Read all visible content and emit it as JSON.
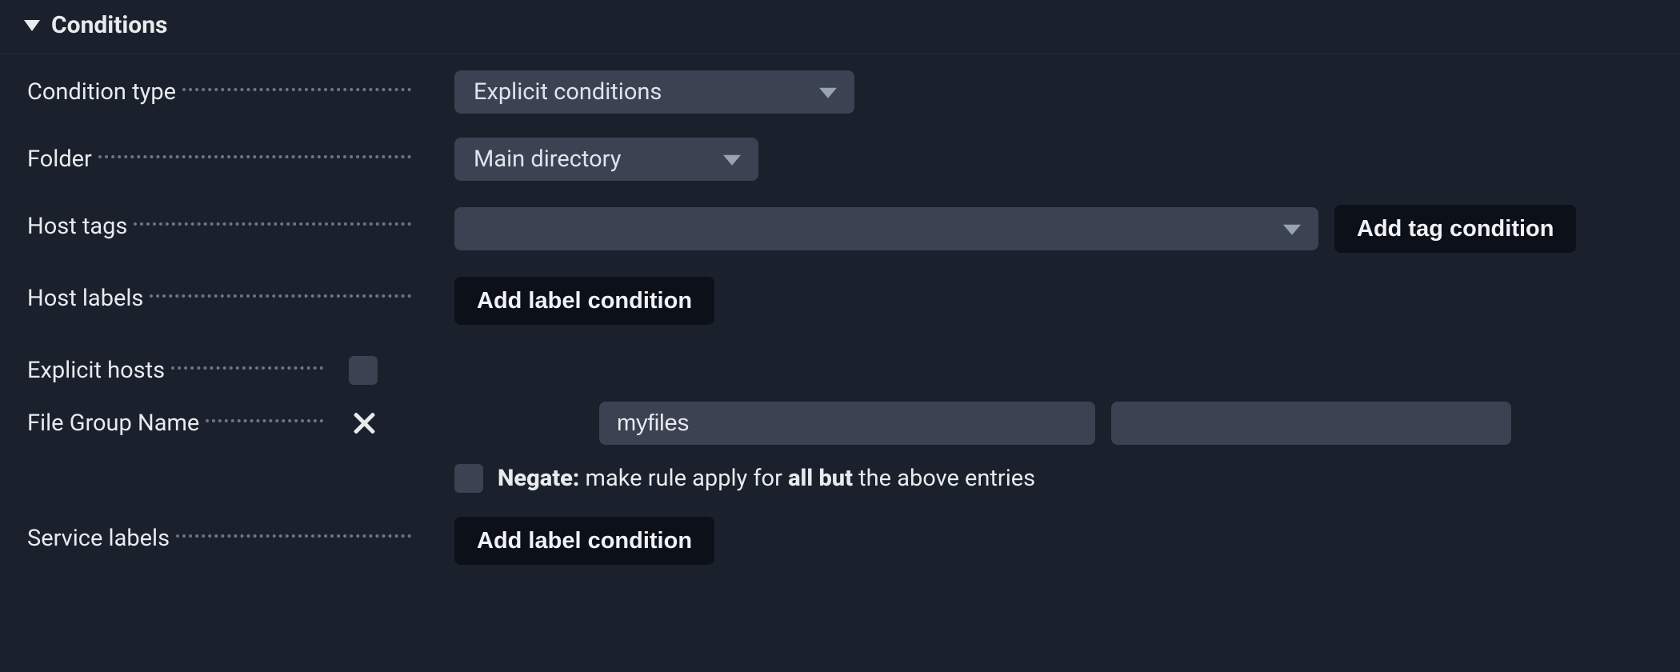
{
  "section": {
    "title": "Conditions"
  },
  "labels": {
    "condition_type": "Condition type",
    "folder": "Folder",
    "host_tags": "Host tags",
    "host_labels": "Host labels",
    "explicit_hosts": "Explicit hosts",
    "file_group_name": "File Group Name",
    "service_labels": "Service labels"
  },
  "condition_type": {
    "selected": "Explicit conditions"
  },
  "folder": {
    "selected": "Main directory"
  },
  "host_tags": {
    "selected": "",
    "button": "Add tag condition"
  },
  "host_labels": {
    "button": "Add label condition"
  },
  "explicit_hosts": {
    "checked": false
  },
  "file_group": {
    "checked": true,
    "value1": "myfiles",
    "value2": "",
    "negate_checked": false,
    "negate_label": "Negate:",
    "negate_text_a": " make rule apply for ",
    "negate_text_b": "all but",
    "negate_text_c": " the above entries"
  },
  "service_labels": {
    "button": "Add label condition"
  }
}
